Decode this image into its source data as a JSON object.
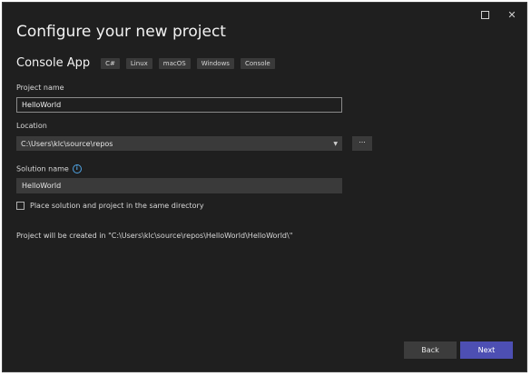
{
  "window": {
    "controls": {
      "maximize": "maximize-icon",
      "close": "✕"
    }
  },
  "header": {
    "title": "Configure your new project"
  },
  "template": {
    "name": "Console App",
    "tags": [
      "C#",
      "Linux",
      "macOS",
      "Windows",
      "Console"
    ]
  },
  "form": {
    "project_name": {
      "label": "Project name",
      "value": "HelloWorld"
    },
    "location": {
      "label": "Location",
      "value": "C:\\Users\\klc\\source\\repos",
      "browse_label": "..."
    },
    "solution_name": {
      "label": "Solution name",
      "info_icon": "i",
      "value": "HelloWorld"
    },
    "same_directory": {
      "label": "Place solution and project in the same directory",
      "checked": false
    },
    "path_note": "Project will be created in \"C:\\Users\\klc\\source\\repos\\HelloWorld\\HelloWorld\\\""
  },
  "footer": {
    "back_label": "Back",
    "next_label": "Next"
  },
  "colors": {
    "background": "#1f1f1f",
    "accent": "#4d4fb3",
    "info": "#4fa3e3"
  }
}
